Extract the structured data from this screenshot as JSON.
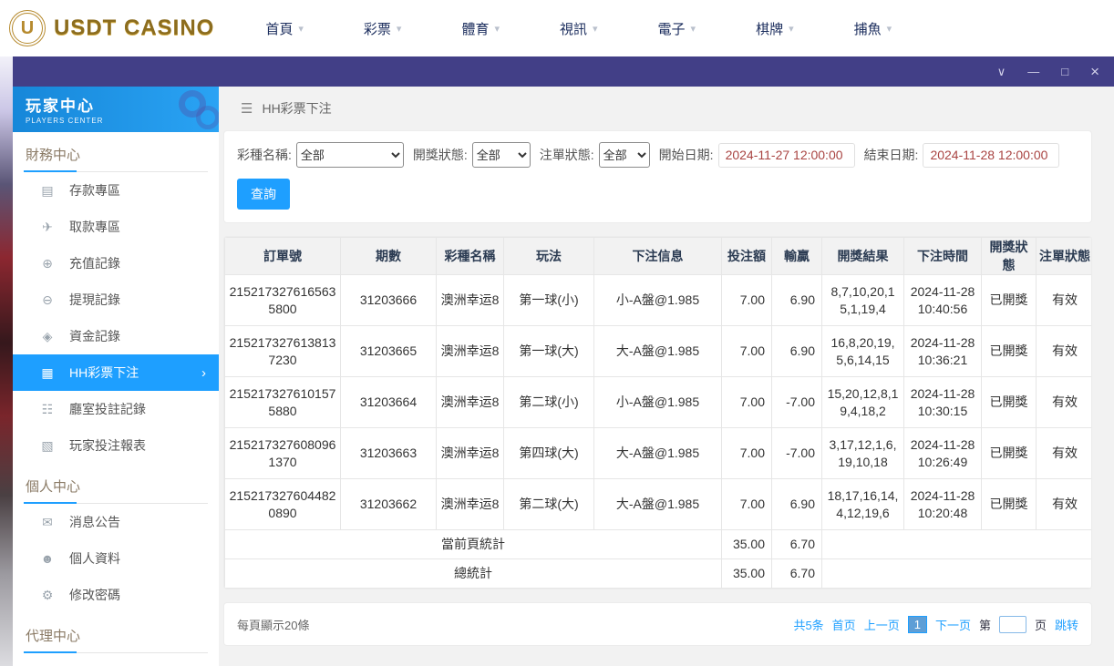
{
  "icons": {
    "logo_u": "U",
    "chevron_down": "▾",
    "window_collapse": "∨",
    "window_minimize": "—",
    "window_maximize": "□",
    "window_close": "×",
    "menu": "☰",
    "deposit": "▤",
    "withdraw": "✈",
    "recharge_record": "⊕",
    "withdraw_record": "⊖",
    "funds_record": "◈",
    "hh_lottery": "▦",
    "hall_record": "☷",
    "player_report": "▧",
    "notice": "✉",
    "profile": "☻",
    "password": "⚙",
    "active_chevron": "›"
  },
  "colors": {
    "accent_blue": "#1e9fff",
    "titlebar_purple": "#423f87",
    "logo_gold": "#8c6d1f"
  },
  "topnav": {
    "logo_text": "USDT CASINO",
    "items": [
      {
        "label": "首頁"
      },
      {
        "label": "彩票"
      },
      {
        "label": "體育"
      },
      {
        "label": "視訊"
      },
      {
        "label": "電子"
      },
      {
        "label": "棋牌"
      },
      {
        "label": "捕魚"
      }
    ]
  },
  "sidebar": {
    "title": "玩家中心",
    "subtitle": "PLAYERS CENTER",
    "sections": [
      {
        "title": "財務中心",
        "items": [
          {
            "label": "存款專區"
          },
          {
            "label": "取款專區"
          },
          {
            "label": "充值記錄"
          },
          {
            "label": "提現記錄"
          },
          {
            "label": "資金記錄"
          },
          {
            "label": "HH彩票下注"
          },
          {
            "label": "廳室投註記錄"
          },
          {
            "label": "玩家投注報表"
          }
        ]
      },
      {
        "title": "個人中心",
        "items": [
          {
            "label": "消息公告"
          },
          {
            "label": "個人資料"
          },
          {
            "label": "修改密碼"
          }
        ]
      },
      {
        "title": "代理中心",
        "items": []
      }
    ]
  },
  "main": {
    "page_title": "HH彩票下注",
    "filters": {
      "lottery_label": "彩種名稱:",
      "lottery_value": "全部",
      "draw_status_label": "開獎狀態:",
      "draw_status_value": "全部",
      "bet_status_label": "注單狀態:",
      "bet_status_value": "全部",
      "start_date_label": "開始日期:",
      "start_date_value": "2024-11-27 12:00:00",
      "end_date_label": "結束日期:",
      "end_date_value": "2024-11-28 12:00:00",
      "search_button": "查詢"
    },
    "table": {
      "headers": [
        "訂單號",
        "期數",
        "彩種名稱",
        "玩法",
        "下注信息",
        "投注額",
        "輸贏",
        "開獎結果",
        "下注時間",
        "開獎狀態",
        "注單狀態"
      ],
      "rows": [
        {
          "order_id": "2152173276165635800",
          "period": "31203666",
          "lottery": "澳洲幸运8",
          "play": "第一球(小)",
          "bet_info": "小-A盤@1.985",
          "amount": "7.00",
          "win": "6.90",
          "result": "8,7,10,20,15,1,19,4",
          "time": "2024-11-28 10:40:56",
          "draw_status": "已開獎",
          "bet_status": "有效"
        },
        {
          "order_id": "2152173276138137230",
          "period": "31203665",
          "lottery": "澳洲幸运8",
          "play": "第一球(大)",
          "bet_info": "大-A盤@1.985",
          "amount": "7.00",
          "win": "6.90",
          "result": "16,8,20,19,5,6,14,15",
          "time": "2024-11-28 10:36:21",
          "draw_status": "已開獎",
          "bet_status": "有效"
        },
        {
          "order_id": "2152173276101575880",
          "period": "31203664",
          "lottery": "澳洲幸运8",
          "play": "第二球(小)",
          "bet_info": "小-A盤@1.985",
          "amount": "7.00",
          "win": "-7.00",
          "result": "15,20,12,8,19,4,18,2",
          "time": "2024-11-28 10:30:15",
          "draw_status": "已開獎",
          "bet_status": "有效"
        },
        {
          "order_id": "2152173276080961370",
          "period": "31203663",
          "lottery": "澳洲幸运8",
          "play": "第四球(大)",
          "bet_info": "大-A盤@1.985",
          "amount": "7.00",
          "win": "-7.00",
          "result": "3,17,12,1,6,19,10,18",
          "time": "2024-11-28 10:26:49",
          "draw_status": "已開獎",
          "bet_status": "有效"
        },
        {
          "order_id": "2152173276044820890",
          "period": "31203662",
          "lottery": "澳洲幸运8",
          "play": "第二球(大)",
          "bet_info": "大-A盤@1.985",
          "amount": "7.00",
          "win": "6.90",
          "result": "18,17,16,14,4,12,19,6",
          "time": "2024-11-28 10:20:48",
          "draw_status": "已開獎",
          "bet_status": "有效"
        }
      ],
      "page_total_label": "當前頁統計",
      "page_total_amount": "35.00",
      "page_total_win": "6.70",
      "grand_total_label": "總統計",
      "grand_total_amount": "35.00",
      "grand_total_win": "6.70"
    },
    "pagination": {
      "page_size_text": "每頁顯示20條",
      "total_text": "共5条",
      "first": "首页",
      "prev": "上一页",
      "current_page": "1",
      "next": "下一页",
      "goto_prefix": "第",
      "goto_suffix": "页",
      "jump": "跳转"
    }
  }
}
